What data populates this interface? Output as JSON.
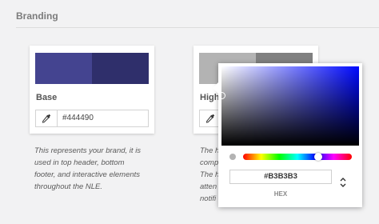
{
  "section": {
    "title": "Branding"
  },
  "cards": {
    "base": {
      "label": "Base",
      "hex_value": "#444490",
      "swatch_colors": [
        "#444490",
        "#2f2f6b"
      ],
      "description_lines": [
        "This represents your brand, it is",
        "used in top header, bottom",
        "footer, and interactive elements",
        "throughout the NLE."
      ]
    },
    "highlight": {
      "label": "High",
      "swatch_colors": [
        "#b3b3b3",
        "#808080"
      ],
      "description_lines": [
        "The h",
        "comp",
        "The h",
        "atten",
        "notifi"
      ]
    }
  },
  "color_picker": {
    "hex_input_value": "#B3B3B3",
    "mode_label": "HEX",
    "hue_color": "#0009ff",
    "preview_color": "#b3b3b3"
  }
}
